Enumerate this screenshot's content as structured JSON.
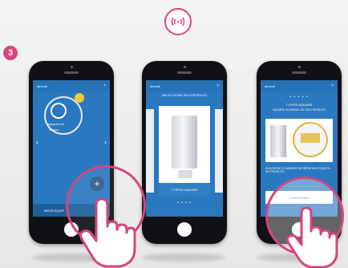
{
  "step": "3",
  "accent": "#d6457f",
  "screen_blue": "#2a78bf",
  "icons": {
    "top": "proximity-sync-icon",
    "plus": "plus-icon",
    "hand": "pointing-hand-icon"
  },
  "screen1": {
    "appbar_title": "airzone",
    "appbar_close": "×",
    "device_line1": "Aquarea Air",
    "device_line2": "Sensor",
    "nav_left": "‹",
    "nav_right": "›",
    "bottom_label": "MEUS EQUIP",
    "plus": "+"
  },
  "screen2": {
    "appbar_title": "airzone",
    "appbar_close": "×",
    "title": "SELECCIONE SEU PRODUTO",
    "product_caption": "T-PROD AQUARE",
    "dots": "• • • •"
  },
  "screen3": {
    "appbar_title": "airzone",
    "appbar_close": "×",
    "dots": "• • • • •",
    "title": "T-PROD AQUARE",
    "subtitle": "AQUARE ZA SERIAL DE SEU PRODUTO",
    "paragraph": "ENCONTRE O NÚMERO DE SÉRIE NA ETIQUETA DO PRODUTO",
    "button": "CONTINUAR"
  }
}
